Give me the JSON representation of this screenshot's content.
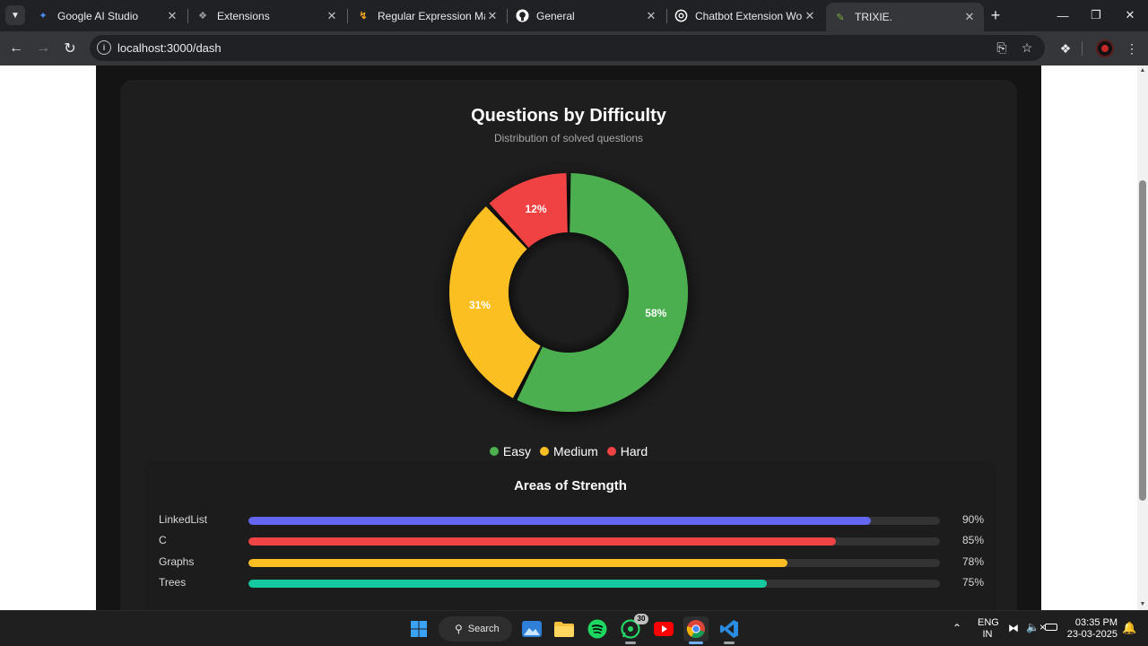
{
  "browser": {
    "tabs": [
      {
        "title": "Google AI Studio",
        "icon": "google-ai-studio-icon",
        "color": "#4c8df6"
      },
      {
        "title": "Extensions",
        "icon": "puzzle-icon",
        "color": "#9aa0a6"
      },
      {
        "title": "Regular Expression Matchi",
        "icon": "leetcode-icon",
        "color": "#f5a623"
      },
      {
        "title": "General",
        "icon": "github-icon",
        "color": "#ffffff"
      },
      {
        "title": "Chatbot Extension Workflo",
        "icon": "openai-icon",
        "color": "#ffffff"
      },
      {
        "title": "TRIXIE.",
        "icon": "brush-icon",
        "color": "#7cb342"
      }
    ],
    "active_tab": 5,
    "url": "localhost:3000/dash"
  },
  "dashboard": {
    "chart_title": "Questions by Difficulty",
    "chart_subtitle": "Distribution of solved questions",
    "strength_title": "Areas of Strength",
    "strengths": [
      {
        "label": "LinkedList",
        "value": 90,
        "pct": "90%",
        "color": "#6366f1"
      },
      {
        "label": "C",
        "value": 85,
        "pct": "85%",
        "color": "#f04343"
      },
      {
        "label": "Graphs",
        "value": 78,
        "pct": "78%",
        "color": "#fbbf24"
      },
      {
        "label": "Trees",
        "value": 75,
        "pct": "75%",
        "color": "#14c8a0"
      }
    ]
  },
  "chart_data": {
    "type": "pie",
    "variant": "donut",
    "title": "Questions by Difficulty",
    "subtitle": "Distribution of solved questions",
    "categories": [
      "Easy",
      "Medium",
      "Hard"
    ],
    "values": [
      58,
      31,
      12
    ],
    "labels": [
      "58%",
      "31%",
      "12%"
    ],
    "colors": [
      "#4caf50",
      "#fbbf24",
      "#f04343"
    ],
    "legend": "bottom"
  },
  "taskbar": {
    "search_label": "Search",
    "whatsapp_badge": "30",
    "lang_top": "ENG",
    "lang_bottom": "IN",
    "time": "03:35 PM",
    "date": "23-03-2025"
  }
}
